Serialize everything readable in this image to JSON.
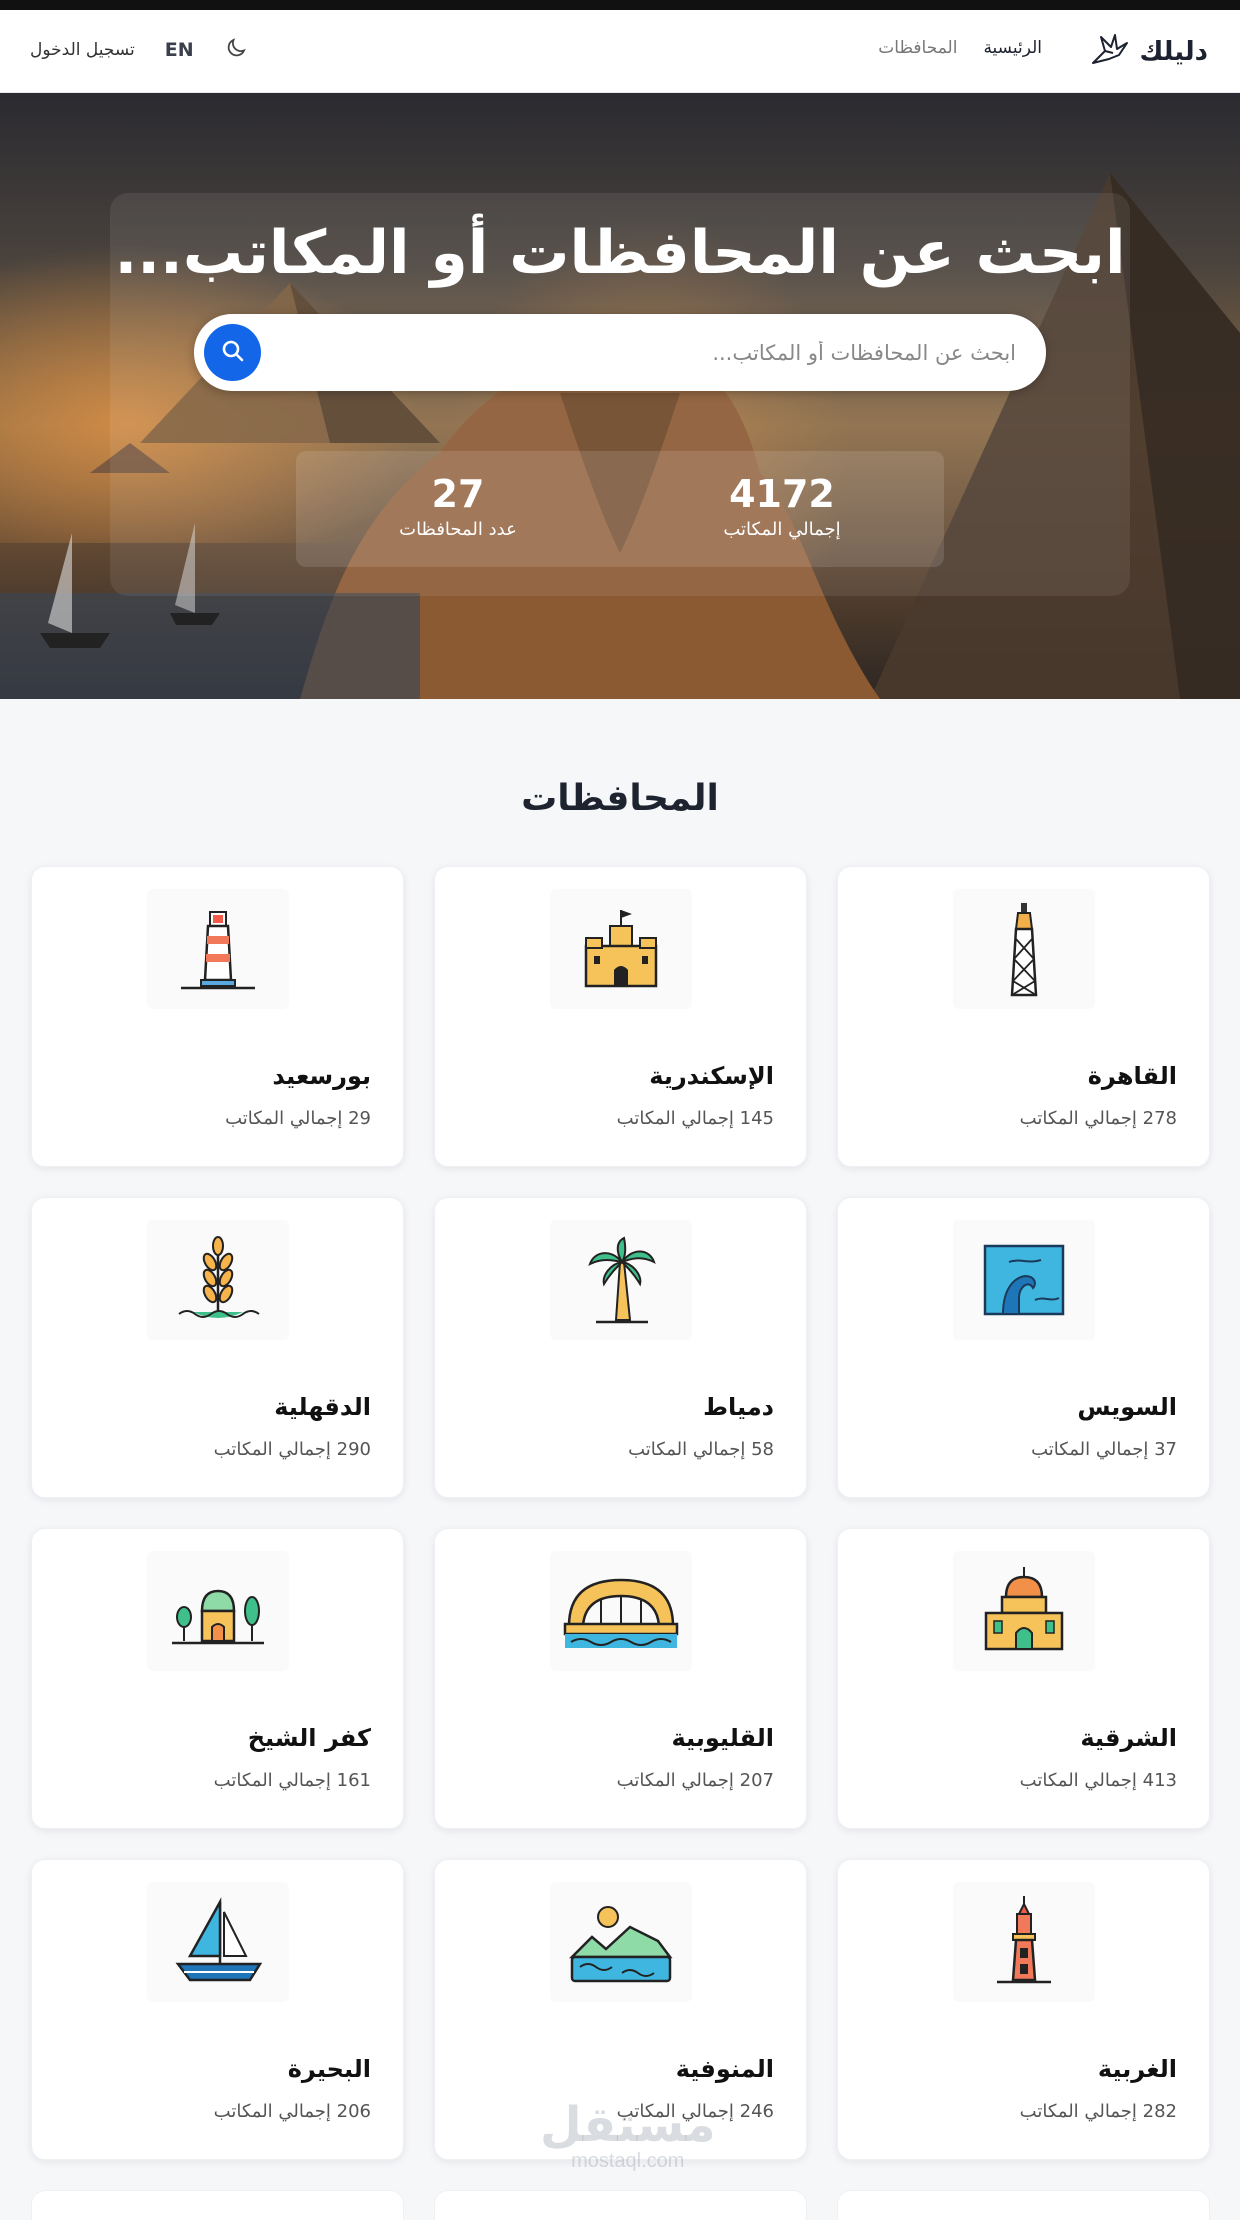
{
  "nav": {
    "brand": "دليلك",
    "links": [
      "الرئيسية",
      "المحافظات"
    ],
    "login": "تسجيل الدخول",
    "lang": "EN"
  },
  "hero": {
    "title": "ابحث عن المحافظات أو المكاتب...",
    "search_placeholder": "ابحث عن المحافظات أو المكاتب...",
    "stats": [
      {
        "value": "4172",
        "label": "إجمالي المكاتب"
      },
      {
        "value": "27",
        "label": "عدد المحافظات"
      }
    ]
  },
  "section": {
    "title": "المحافظات"
  },
  "count_suffix": "إجمالي المكاتب",
  "governorates": [
    {
      "name": "القاهرة",
      "count": "278",
      "icon": "cairo-tower-icon"
    },
    {
      "name": "الإسكندرية",
      "count": "145",
      "icon": "citadel-icon"
    },
    {
      "name": "بورسعيد",
      "count": "29",
      "icon": "lighthouse-icon"
    },
    {
      "name": "السويس",
      "count": "37",
      "icon": "canal-wave-icon"
    },
    {
      "name": "دمياط",
      "count": "58",
      "icon": "palm-tree-icon"
    },
    {
      "name": "الدقهلية",
      "count": "290",
      "icon": "wheat-icon"
    },
    {
      "name": "الشرقية",
      "count": "413",
      "icon": "mosque-icon"
    },
    {
      "name": "القليوبية",
      "count": "207",
      "icon": "bridge-icon"
    },
    {
      "name": "كفر الشيخ",
      "count": "161",
      "icon": "shrine-trees-icon"
    },
    {
      "name": "الغربية",
      "count": "282",
      "icon": "minaret-icon"
    },
    {
      "name": "المنوفية",
      "count": "246",
      "icon": "landscape-icon"
    },
    {
      "name": "البحيرة",
      "count": "206",
      "icon": "sailboat-icon"
    }
  ],
  "watermark": {
    "ar": "مستقل",
    "en": "mostaql.com"
  }
}
